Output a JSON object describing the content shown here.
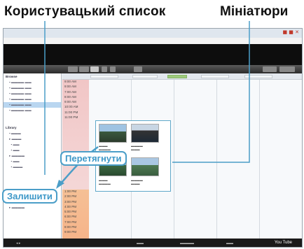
{
  "annotations": {
    "user_list_label": "Користувацький список",
    "thumbnails_label": "Мініатюри",
    "drag_label": "Перетягнути",
    "leave_label": "Залишити"
  },
  "sidebar": {
    "heading_top": "Browse",
    "heading_library": "Library"
  },
  "times": {
    "morning": [
      "9:00 AM",
      "9:00 AM",
      "7:00 AM",
      "8:00 AM",
      "9:00 AM",
      "10:00 AM",
      "11:00 PM",
      "11:00 PM"
    ],
    "evening": [
      "1:00 PM",
      "2:00 PM",
      "3:00 PM",
      "4:00 PM",
      "5:00 PM",
      "6:00 PM",
      "7:00 PM",
      "8:00 PM",
      "9:00 PM"
    ]
  },
  "bottom": {
    "youtube": "You Tube"
  },
  "colors": {
    "accent": "#4b9ec8",
    "timeline_pink": "#f1c6c6",
    "timeline_orange": "#f5b48a"
  }
}
